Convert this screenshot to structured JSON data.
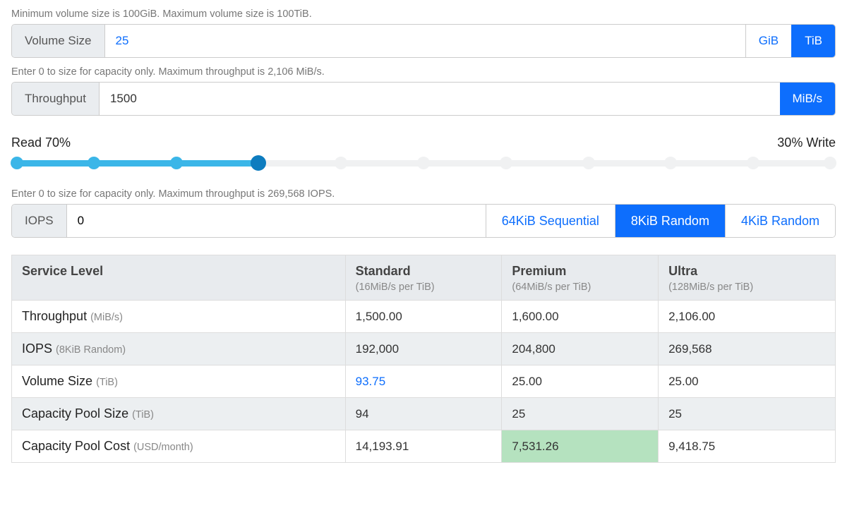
{
  "volume_size": {
    "help": "Minimum volume size is 100GiB. Maximum volume size is 100TiB.",
    "label": "Volume Size",
    "value": "25",
    "units": [
      "GiB",
      "TiB"
    ],
    "active_unit": "TiB"
  },
  "throughput": {
    "help": "Enter 0 to size for capacity only. Maximum throughput is 2,106 MiB/s.",
    "label": "Throughput",
    "value": "1500",
    "unit": "MiB/s"
  },
  "slider": {
    "left_label": "Read 70%",
    "right_label": "30% Write",
    "percent": 30
  },
  "iops": {
    "help": "Enter 0 to size for capacity only. Maximum throughput is 269,568 IOPS.",
    "label": "IOPS",
    "value": "0",
    "options": [
      "64KiB Sequential",
      "8KiB Random",
      "4KiB Random"
    ],
    "active_option": "8KiB Random"
  },
  "table": {
    "header": {
      "service_level": "Service Level",
      "standard": {
        "name": "Standard",
        "sub": "(16MiB/s per TiB)"
      },
      "premium": {
        "name": "Premium",
        "sub": "(64MiB/s per TiB)"
      },
      "ultra": {
        "name": "Ultra",
        "sub": "(128MiB/s per TiB)"
      }
    },
    "rows": [
      {
        "label": "Throughput",
        "paren": "(MiB/s)",
        "standard": "1,500.00",
        "premium": "1,600.00",
        "ultra": "2,106.00"
      },
      {
        "label": "IOPS",
        "paren": "(8KiB Random)",
        "standard": "192,000",
        "premium": "204,800",
        "ultra": "269,568"
      },
      {
        "label": "Volume Size",
        "paren": "(TiB)",
        "standard": "93.75",
        "premium": "25.00",
        "ultra": "25.00",
        "standard_link": true
      },
      {
        "label": "Capacity Pool Size",
        "paren": "(TiB)",
        "standard": "94",
        "premium": "25",
        "ultra": "25"
      },
      {
        "label": "Capacity Pool Cost",
        "paren": "(USD/month)",
        "standard": "14,193.91",
        "premium": "7,531.26",
        "ultra": "9,418.75",
        "premium_highlight": true
      }
    ]
  }
}
